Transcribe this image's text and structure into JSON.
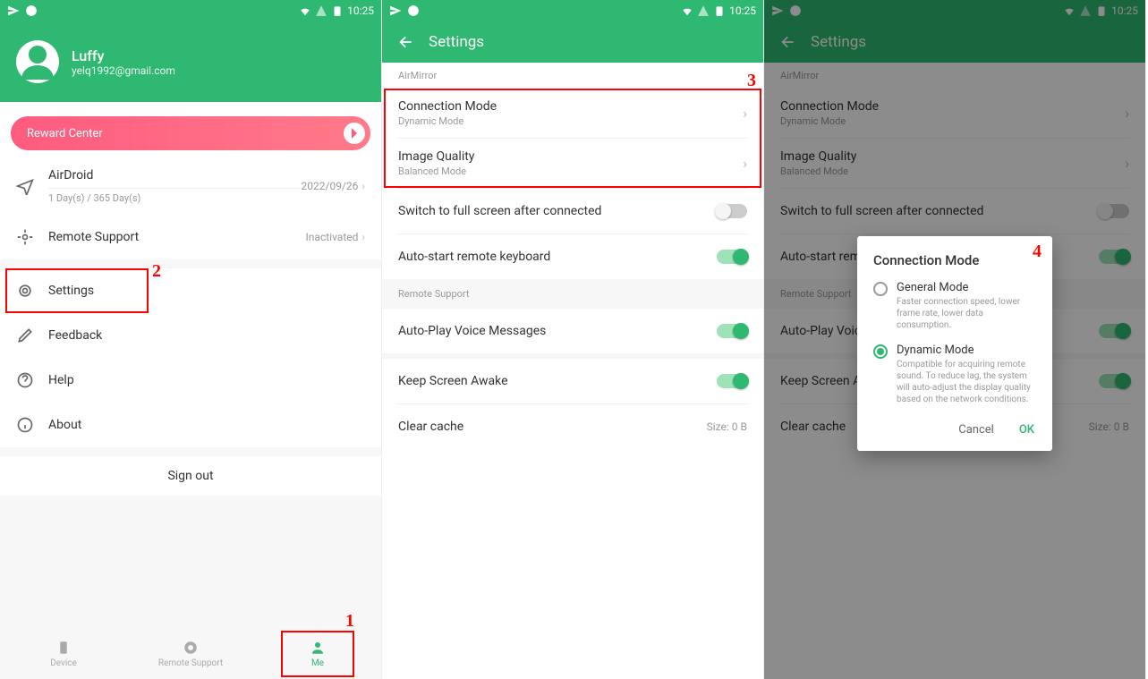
{
  "status": {
    "time": "10:25"
  },
  "panel1": {
    "user": {
      "name": "Luffy",
      "email": "yelq1992@gmail.com"
    },
    "reward": "Reward Center",
    "rows": {
      "airdroid": {
        "title": "AirDroid",
        "sub": "1 Day(s) / 365 Day(s)",
        "right": "2022/09/26"
      },
      "remote": {
        "title": "Remote Support",
        "right": "Inactivated"
      },
      "settings": "Settings",
      "feedback": "Feedback",
      "help": "Help",
      "about": "About"
    },
    "signout": "Sign out",
    "nav": {
      "device": "Device",
      "remote": "Remote Support",
      "me": "Me"
    }
  },
  "panel2": {
    "title": "Settings",
    "sections": {
      "airmirror": "AirMirror",
      "remote": "Remote Support"
    },
    "rows": {
      "conn": {
        "title": "Connection Mode",
        "sub": "Dynamic Mode"
      },
      "img": {
        "title": "Image Quality",
        "sub": "Balanced Mode"
      },
      "fullscreen": "Switch to full screen after connected",
      "keyboard": "Auto-start remote keyboard",
      "voice": "Auto-Play Voice Messages",
      "awake": "Keep Screen Awake",
      "cache": {
        "title": "Clear cache",
        "right": "Size: 0 B"
      }
    }
  },
  "dialog": {
    "title": "Connection Mode",
    "opt1": {
      "title": "General Mode",
      "desc": "Faster connection speed, lower frame rate, lower data consumption."
    },
    "opt2": {
      "title": "Dynamic Mode",
      "desc": "Compatible for acquiring remote sound. To reduce lag, the system will auto-adjust the display quality based on the network conditions."
    },
    "cancel": "Cancel",
    "ok": "OK"
  },
  "annotations": {
    "n1": "1",
    "n2": "2",
    "n3": "3",
    "n4": "4"
  }
}
